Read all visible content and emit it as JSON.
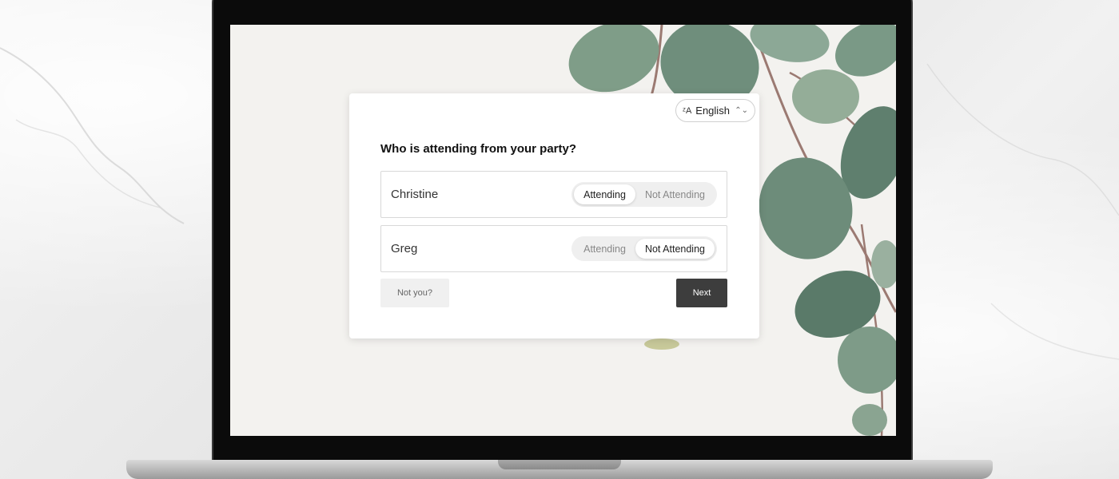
{
  "language": {
    "icon": "translate-icon",
    "label": "English",
    "chevron": "updown-chevron-icon"
  },
  "question": "Who is attending from your party?",
  "guests": [
    {
      "name": "Christine",
      "options": [
        "Attending",
        "Not Attending"
      ],
      "selected": "Attending"
    },
    {
      "name": "Greg",
      "options": [
        "Attending",
        "Not Attending"
      ],
      "selected": "Not Attending"
    }
  ],
  "buttons": {
    "not_you": "Not you?",
    "next": "Next"
  },
  "colors": {
    "primary_button": "#3d3d3d",
    "card": "#ffffff",
    "leaf": "#6f8e7c"
  }
}
